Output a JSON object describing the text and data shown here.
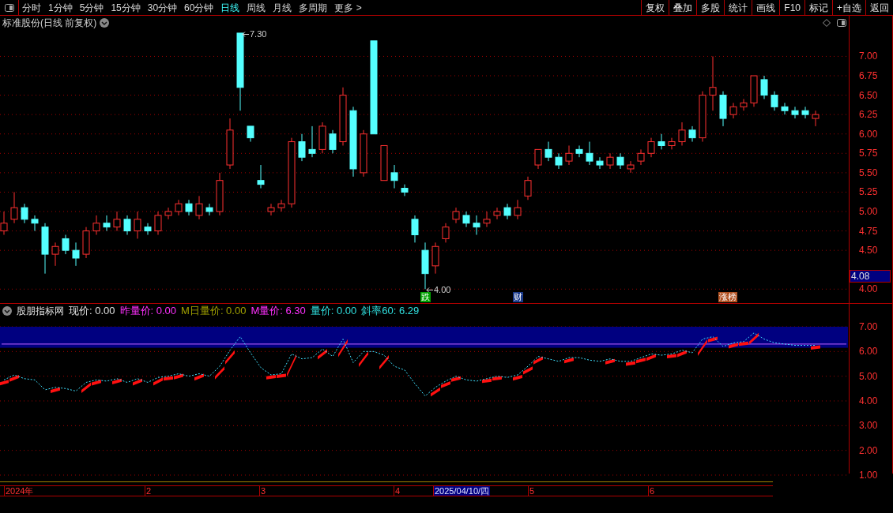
{
  "toolbar": {
    "periods": [
      {
        "label": "分时",
        "selected": false
      },
      {
        "label": "1分钟",
        "selected": false
      },
      {
        "label": "5分钟",
        "selected": false
      },
      {
        "label": "15分钟",
        "selected": false
      },
      {
        "label": "30分钟",
        "selected": false
      },
      {
        "label": "60分钟",
        "selected": false
      },
      {
        "label": "日线",
        "selected": true
      },
      {
        "label": "周线",
        "selected": false
      },
      {
        "label": "月线",
        "selected": false
      },
      {
        "label": "多周期",
        "selected": false
      },
      {
        "label": "更多 >",
        "selected": false
      }
    ],
    "buttons": [
      "复权",
      "叠加",
      "多股",
      "统计",
      "画线",
      "F10",
      "标记",
      "+自选",
      "返回"
    ]
  },
  "main_chart": {
    "title": "标准股份(日线 前复权)",
    "high_label": "7.30",
    "low_label": "4.00",
    "current_price": "4.08",
    "markers": [
      {
        "text": "跌",
        "color": "#00a000"
      },
      {
        "text": "财",
        "color": "#1a3a8a"
      },
      {
        "text": "涨榜",
        "color": "#b05020"
      }
    ],
    "axis_labels": [
      "7.00",
      "6.75",
      "6.50",
      "6.25",
      "6.00",
      "5.75",
      "5.50",
      "5.25",
      "5.00",
      "4.75",
      "4.50",
      "4.00"
    ]
  },
  "indicator": {
    "name": "股朋指标网",
    "values": [
      {
        "text": "现价: 0.00",
        "color": "#e0e0e0"
      },
      {
        "text": "昨量价: 0.00",
        "color": "#ff30ff"
      },
      {
        "text": "M日量价: 0.00",
        "color": "#a0a000"
      },
      {
        "text": "M量价: 6.30",
        "color": "#ff30ff"
      },
      {
        "text": "量价: 0.00",
        "color": "#30e0e0"
      },
      {
        "text": "斜率60: 6.29",
        "color": "#30e0e0"
      }
    ],
    "axis_labels": [
      "7.00",
      "6.00",
      "5.00",
      "4.00",
      "3.00",
      "2.00",
      "1.00"
    ]
  },
  "date_axis": [
    {
      "label": "2024年",
      "selected": false
    },
    {
      "label": "2",
      "selected": false
    },
    {
      "label": "3",
      "selected": false
    },
    {
      "label": "4",
      "selected": false
    },
    {
      "label": "2025/04/10/四",
      "selected": true
    },
    {
      "label": "5",
      "selected": false
    },
    {
      "label": "6",
      "selected": false
    }
  ]
}
